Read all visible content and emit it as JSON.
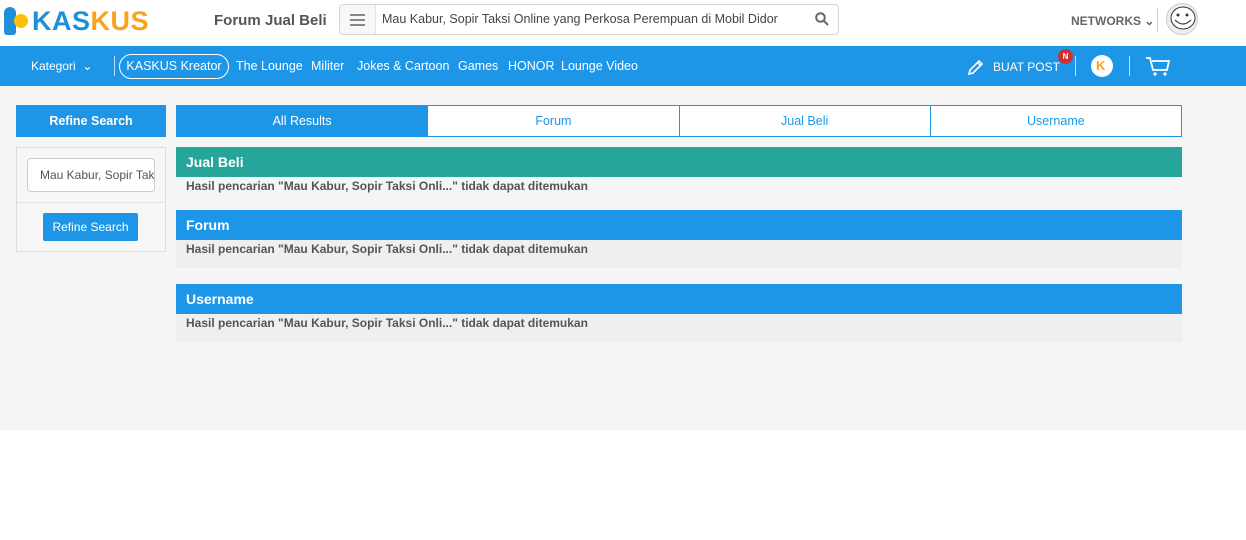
{
  "header": {
    "logo_text_blue": "KAS",
    "logo_text_orange": "KUS",
    "links": [
      "Forum",
      "Jual Beli"
    ],
    "search_value": "Mau Kabur, Sopir Taksi Online yang Perkosa Perempuan di Mobil Didor",
    "networks_label": "NETWORKS"
  },
  "nav": {
    "kategori": "Kategori",
    "kreator": "KASKUS Kreator",
    "items": [
      "The Lounge",
      "Militer",
      "Jokes & Cartoon",
      "Games",
      "HONOR",
      "Lounge Video"
    ],
    "buat_post": "BUAT POST",
    "badge": "N"
  },
  "sidebar": {
    "title": "Refine Search",
    "input_value": "Mau Kabur, Sopir Taksi Online yang Perkosa Perempuan di Mobil Didor",
    "button": "Refine Search"
  },
  "tabs": [
    "All Results",
    "Forum",
    "Jual Beli",
    "Username"
  ],
  "sections": [
    {
      "title": "Jual Beli",
      "message": "Hasil pencarian \"Mau Kabur, Sopir Taksi Onli...\" tidak dapat ditemukan",
      "color": "#26a69a"
    },
    {
      "title": "Forum",
      "message": "Hasil pencarian \"Mau Kabur, Sopir Taksi Onli...\" tidak dapat ditemukan",
      "color": "#1e96e8"
    },
    {
      "title": "Username",
      "message": "Hasil pencarian \"Mau Kabur, Sopir Taksi Onli...\" tidak dapat ditemukan",
      "color": "#1e96e8"
    }
  ],
  "colors": {
    "brand_blue": "#1e96e8",
    "brand_orange": "#f7a41d",
    "teal": "#26a69a"
  }
}
